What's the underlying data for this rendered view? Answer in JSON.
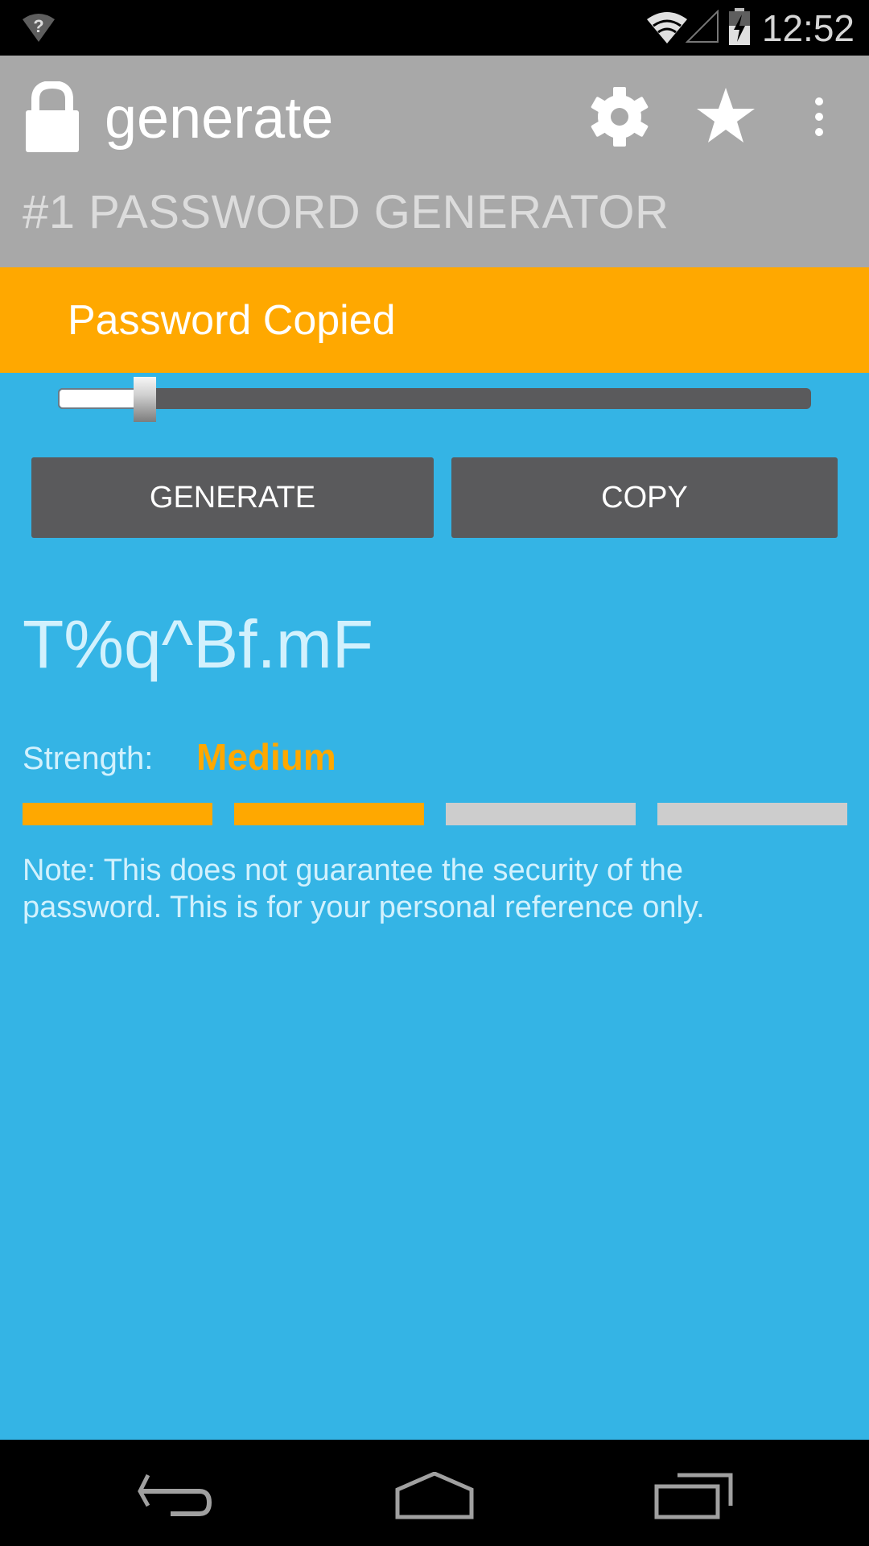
{
  "status_bar": {
    "time": "12:52",
    "icons": [
      "wifi-unknown-icon",
      "wifi-icon",
      "signal-icon",
      "battery-charging-icon"
    ]
  },
  "action_bar": {
    "app_icon": "lock-icon",
    "title": "generate",
    "subtitle": "#1 PASSWORD GENERATOR",
    "actions": [
      "settings-icon",
      "star-icon",
      "overflow-menu-icon"
    ]
  },
  "toast": {
    "message": "Password Copied"
  },
  "length_slider": {
    "value_fraction": 0.1
  },
  "buttons": {
    "generate_label": "GENERATE",
    "copy_label": "COPY"
  },
  "password": {
    "value": "T%q^Bf.mF"
  },
  "strength": {
    "label": "Strength:",
    "value": "Medium",
    "filled_segments": 2,
    "total_segments": 4
  },
  "note": "Note: This does not guarantee the security of the password. This is for your personal reference only.",
  "nav_bar": {
    "buttons": [
      "back-icon",
      "home-icon",
      "recents-icon"
    ]
  },
  "colors": {
    "accent": "#ffa800",
    "background": "#34b4e5",
    "action_bar": "#a8a8a8",
    "button": "#5a5a5c",
    "meter_off": "#cdcdcd"
  }
}
